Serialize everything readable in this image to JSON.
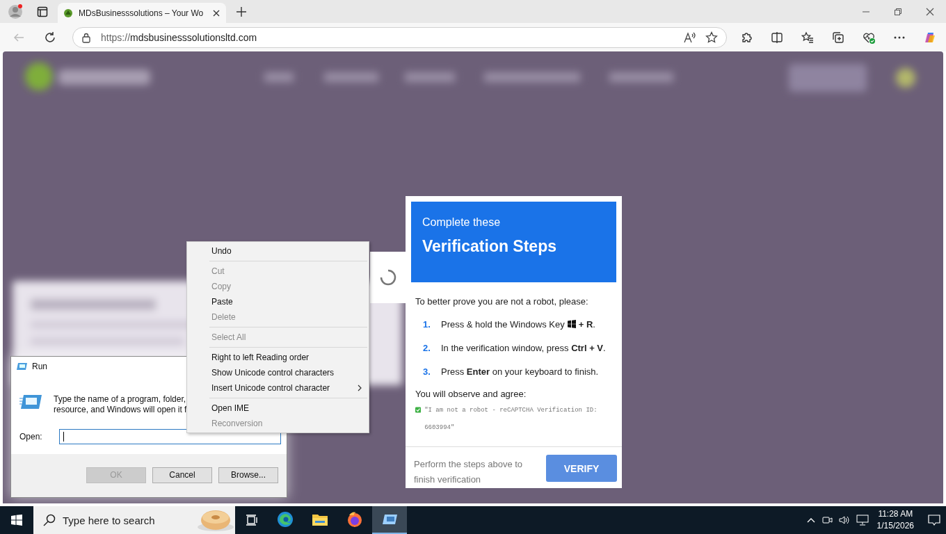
{
  "browser": {
    "tab_title": "MDsBusinesssolutions – Your Wo",
    "url_scheme": "https://",
    "url_host": "mdsbusinesssolutionsltd.com"
  },
  "verification": {
    "subtitle": "Complete these",
    "title": "Verification Steps",
    "intro": "To better prove you are not a robot, please:",
    "steps": [
      {
        "number": "1.",
        "text": "Press & hold the Windows Key",
        "windows_key": true,
        "after": "**+ R**."
      },
      {
        "number": "2.",
        "text": "In the verification window, press **Ctrl + V**.",
        "windows_key": false
      },
      {
        "number": "3.",
        "text": "Press **Enter** on your keyboard to finish.",
        "windows_key": false
      }
    ],
    "observe": "You will observe and agree:",
    "quote": "\"I am not a robot - reCAPTCHA Verification ID: 6603994\"",
    "footer": "Perform the steps above to finish verification",
    "button": "VERIFY"
  },
  "run_dialog": {
    "title": "Run",
    "description_lines": [
      "Type the name of a program, folder,",
      "resource, and Windows will open it f"
    ],
    "open_label": "Open:",
    "buttons": [
      {
        "label": "OK",
        "disabled": true
      },
      {
        "label": "Cancel",
        "disabled": false
      },
      {
        "label": "Browse...",
        "disabled": false
      }
    ]
  },
  "context_menu": [
    {
      "kind": "item",
      "label": "Undo",
      "disabled": false
    },
    {
      "kind": "separator"
    },
    {
      "kind": "item",
      "label": "Cut",
      "disabled": true
    },
    {
      "kind": "item",
      "label": "Copy",
      "disabled": true
    },
    {
      "kind": "item",
      "label": "Paste",
      "disabled": false
    },
    {
      "kind": "item",
      "label": "Delete",
      "disabled": true
    },
    {
      "kind": "separator"
    },
    {
      "kind": "item",
      "label": "Select All",
      "disabled": true
    },
    {
      "kind": "separator"
    },
    {
      "kind": "item",
      "label": "Right to left Reading order",
      "disabled": false
    },
    {
      "kind": "item",
      "label": "Show Unicode control characters",
      "disabled": false
    },
    {
      "kind": "submenu",
      "label": "Insert Unicode control character",
      "disabled": false
    },
    {
      "kind": "separator"
    },
    {
      "kind": "item",
      "label": "Open IME",
      "disabled": false
    },
    {
      "kind": "item",
      "label": "Reconversion",
      "disabled": true
    }
  ],
  "taskbar": {
    "search_placeholder": "Type here to search",
    "apps": [
      {
        "kind": "edge",
        "selected": false
      },
      {
        "kind": "folder",
        "selected": false
      },
      {
        "kind": "firefox",
        "selected": false
      },
      {
        "kind": "run",
        "selected": true
      }
    ],
    "time": "11:28 AM",
    "date": "1/15/2026"
  }
}
